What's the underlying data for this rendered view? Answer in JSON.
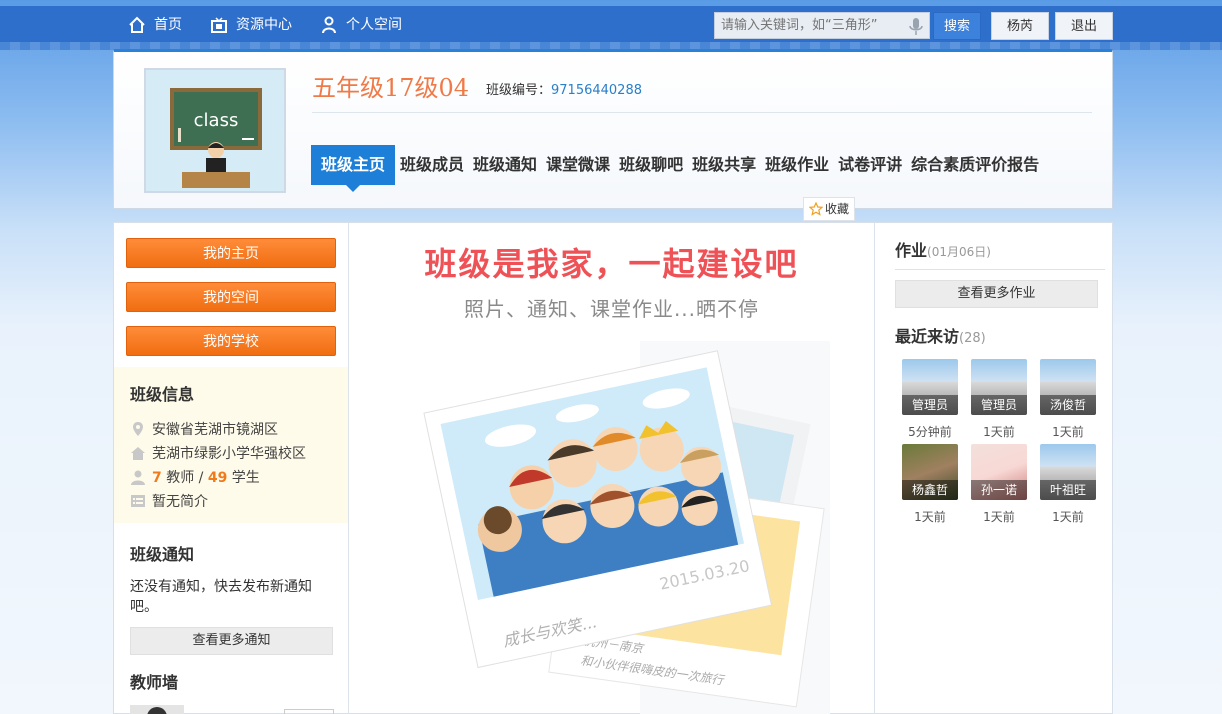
{
  "topnav": {
    "items": [
      {
        "label": "首页",
        "icon": "home-icon"
      },
      {
        "label": "资源中心",
        "icon": "resource-icon"
      },
      {
        "label": "个人空间",
        "icon": "user-icon"
      }
    ],
    "search_placeholder": "请输入关键词，如“三角形”",
    "search_button": "搜索",
    "user_button": "杨芮",
    "logout_button": "退出"
  },
  "header": {
    "avatar_text": "class",
    "class_name": "五年级17级04",
    "code_label": "班级编号：",
    "code_value": "97156440288",
    "tabs": [
      "班级主页",
      "班级成员",
      "班级通知",
      "课堂微课",
      "班级聊吧",
      "班级共享",
      "班级作业",
      "试卷评讲",
      "综合素质评价报告"
    ],
    "active_tab": "班级主页",
    "favorite": "收藏"
  },
  "left": {
    "buttons": [
      "我的主页",
      "我的空间",
      "我的学校"
    ],
    "info_title": "班级信息",
    "location": "安徽省芜湖市镜湖区",
    "school": "芜湖市绿影小学华强校区",
    "teacher_count": "7",
    "teacher_label": "教师",
    "separator": "/",
    "student_count": "49",
    "student_label": "学生",
    "intro": "暂无简介",
    "notice_title": "班级通知",
    "notice_text": "还没有通知，快去发布新通知吧。",
    "notice_more": "查看更多通知",
    "teacher_wall_title": "教师墙"
  },
  "center": {
    "title": "班级是我家，一起建设吧",
    "subtitle": "照片、通知、课堂作业...晒不停",
    "photo_date": "2015.03.20",
    "photo_caption": "成长与欢笑...",
    "postcard_place": "杭州",
    "postcard_line1": "杭州－南京",
    "postcard_line2": "和小伙伴很嗨皮的一次旅行"
  },
  "right": {
    "homework_title": "作业",
    "homework_date": "(01月06日)",
    "homework_more": "查看更多作业",
    "visitors_title": "最近来访",
    "visitors_count": "(28)",
    "visitors": [
      {
        "name": "管理员",
        "time": "5分钟前"
      },
      {
        "name": "管理员",
        "time": "1天前"
      },
      {
        "name": "汤俊哲",
        "time": "1天前"
      },
      {
        "name": "杨鑫哲",
        "time": "1天前"
      },
      {
        "name": "孙一诺",
        "time": "1天前"
      },
      {
        "name": "叶祖旺",
        "time": "1天前"
      }
    ]
  },
  "colors": {
    "topbar": "#2f6fcc",
    "accent_blue": "#1d7fd8",
    "orange": "#f06d10",
    "class_name": "#f07a47",
    "banner_red": "#ee5257"
  }
}
